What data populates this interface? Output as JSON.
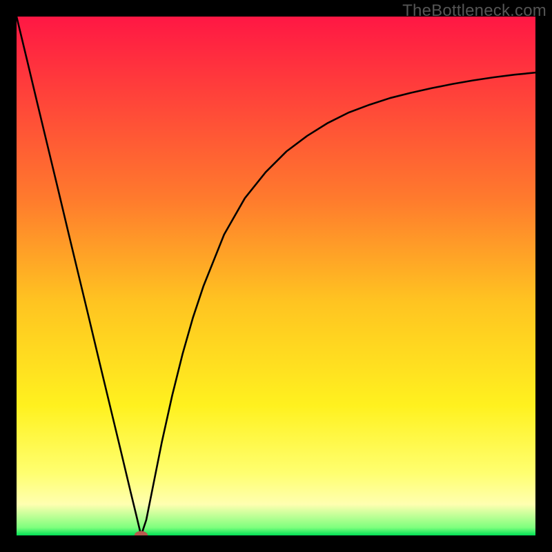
{
  "watermark": "TheBottleneck.com",
  "chart_data": {
    "type": "line",
    "title": "",
    "xlabel": "",
    "ylabel": "",
    "xlim": [
      0,
      100
    ],
    "ylim": [
      0,
      100
    ],
    "grid": false,
    "legend": false,
    "background_gradient": {
      "stops": [
        {
          "offset": 0.0,
          "color": "#ff1744"
        },
        {
          "offset": 0.35,
          "color": "#ff7a2d"
        },
        {
          "offset": 0.55,
          "color": "#ffc421"
        },
        {
          "offset": 0.75,
          "color": "#fff11f"
        },
        {
          "offset": 0.88,
          "color": "#ffff70"
        },
        {
          "offset": 0.94,
          "color": "#ffffb0"
        },
        {
          "offset": 0.985,
          "color": "#7dff7d"
        },
        {
          "offset": 1.0,
          "color": "#00e055"
        }
      ]
    },
    "series": [
      {
        "name": "curve",
        "color": "#000000",
        "x": [
          0,
          2,
          4,
          6,
          8,
          10,
          12,
          14,
          16,
          18,
          20,
          22,
          23,
          24,
          25,
          26,
          28,
          30,
          32,
          34,
          36,
          38,
          40,
          44,
          48,
          52,
          56,
          60,
          64,
          68,
          72,
          76,
          80,
          84,
          88,
          92,
          96,
          100
        ],
        "y": [
          100,
          91.7,
          83.3,
          75.0,
          66.7,
          58.3,
          50.0,
          41.7,
          33.3,
          25.0,
          16.7,
          8.3,
          4.2,
          0.0,
          3.0,
          8.0,
          18.0,
          27.0,
          35.0,
          42.0,
          48.0,
          53.0,
          58.0,
          65.0,
          70.0,
          74.0,
          77.0,
          79.5,
          81.5,
          83.0,
          84.3,
          85.3,
          86.2,
          87.0,
          87.7,
          88.3,
          88.8,
          89.2
        ]
      }
    ],
    "marker": {
      "x": 24,
      "y": 0,
      "rx": 1.3,
      "ry": 0.85,
      "color": "#b7594e"
    }
  }
}
